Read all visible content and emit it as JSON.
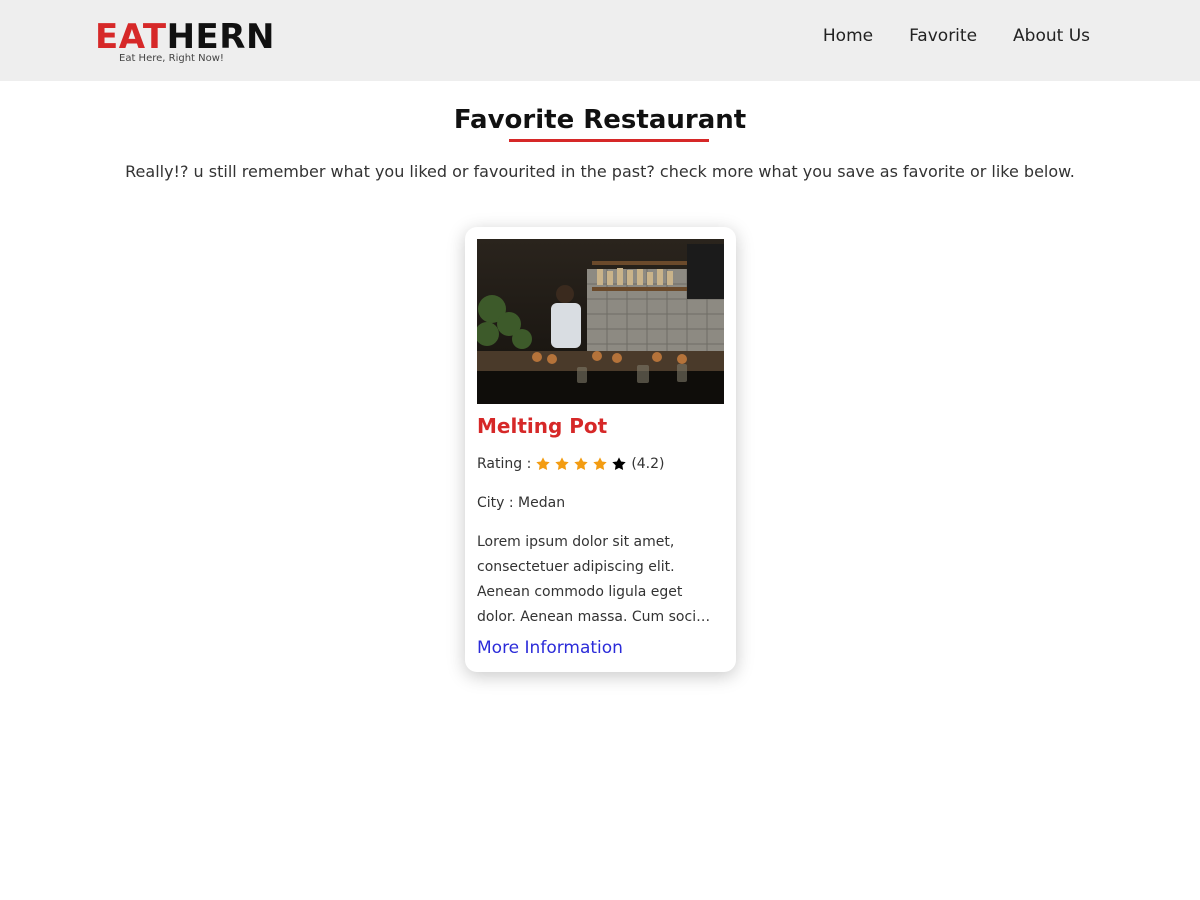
{
  "brand": {
    "name_red": "EAT",
    "name_black": "HERN",
    "tagline": "Eat Here, Right Now!",
    "accent_color": "#d62828"
  },
  "nav": {
    "items": [
      {
        "label": "Home"
      },
      {
        "label": "Favorite"
      },
      {
        "label": "About Us"
      }
    ]
  },
  "main": {
    "title": "Favorite Restaurant",
    "subtitle": "Really!? u still remember what you liked or favourited in the past? check more what you save as favorite or like below."
  },
  "restaurants": [
    {
      "name": "Melting Pot",
      "rating_label": "Rating :",
      "rating": 4.2,
      "rating_text": "(4.2)",
      "stars_filled": 4,
      "stars_total": 5,
      "city_text": "City : Medan",
      "description": "Lorem ipsum dolor sit amet, consectetuer adipiscing elit. Aenean commodo ligula eget dolor. Aenean massa. Cum soci…",
      "link_label": "More Information",
      "star_color": "#f39c12",
      "link_color": "#2b2bd9"
    }
  ]
}
